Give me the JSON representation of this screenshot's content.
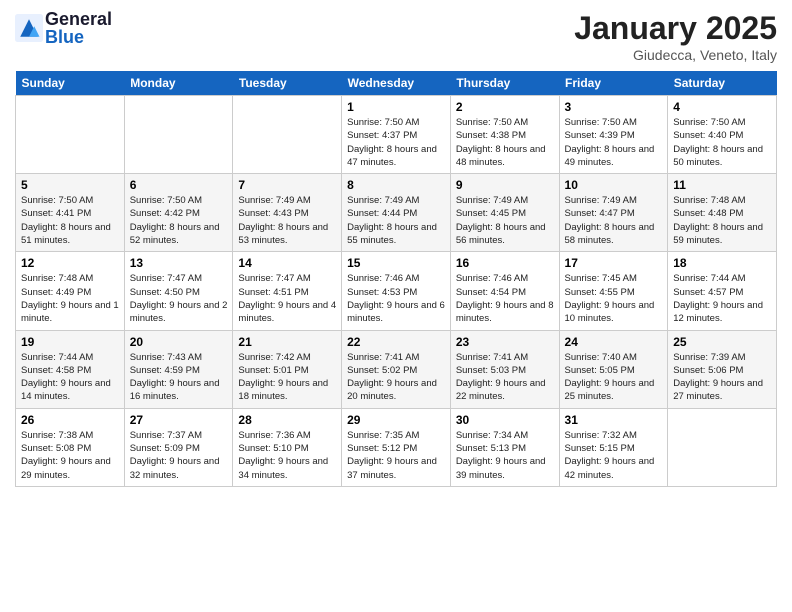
{
  "logo": {
    "text_general": "General",
    "text_blue": "Blue"
  },
  "header": {
    "month": "January 2025",
    "location": "Giudecca, Veneto, Italy"
  },
  "weekdays": [
    "Sunday",
    "Monday",
    "Tuesday",
    "Wednesday",
    "Thursday",
    "Friday",
    "Saturday"
  ],
  "weeks": [
    [
      {
        "day": "",
        "info": ""
      },
      {
        "day": "",
        "info": ""
      },
      {
        "day": "",
        "info": ""
      },
      {
        "day": "1",
        "info": "Sunrise: 7:50 AM\nSunset: 4:37 PM\nDaylight: 8 hours and 47 minutes."
      },
      {
        "day": "2",
        "info": "Sunrise: 7:50 AM\nSunset: 4:38 PM\nDaylight: 8 hours and 48 minutes."
      },
      {
        "day": "3",
        "info": "Sunrise: 7:50 AM\nSunset: 4:39 PM\nDaylight: 8 hours and 49 minutes."
      },
      {
        "day": "4",
        "info": "Sunrise: 7:50 AM\nSunset: 4:40 PM\nDaylight: 8 hours and 50 minutes."
      }
    ],
    [
      {
        "day": "5",
        "info": "Sunrise: 7:50 AM\nSunset: 4:41 PM\nDaylight: 8 hours and 51 minutes."
      },
      {
        "day": "6",
        "info": "Sunrise: 7:50 AM\nSunset: 4:42 PM\nDaylight: 8 hours and 52 minutes."
      },
      {
        "day": "7",
        "info": "Sunrise: 7:49 AM\nSunset: 4:43 PM\nDaylight: 8 hours and 53 minutes."
      },
      {
        "day": "8",
        "info": "Sunrise: 7:49 AM\nSunset: 4:44 PM\nDaylight: 8 hours and 55 minutes."
      },
      {
        "day": "9",
        "info": "Sunrise: 7:49 AM\nSunset: 4:45 PM\nDaylight: 8 hours and 56 minutes."
      },
      {
        "day": "10",
        "info": "Sunrise: 7:49 AM\nSunset: 4:47 PM\nDaylight: 8 hours and 58 minutes."
      },
      {
        "day": "11",
        "info": "Sunrise: 7:48 AM\nSunset: 4:48 PM\nDaylight: 8 hours and 59 minutes."
      }
    ],
    [
      {
        "day": "12",
        "info": "Sunrise: 7:48 AM\nSunset: 4:49 PM\nDaylight: 9 hours and 1 minute."
      },
      {
        "day": "13",
        "info": "Sunrise: 7:47 AM\nSunset: 4:50 PM\nDaylight: 9 hours and 2 minutes."
      },
      {
        "day": "14",
        "info": "Sunrise: 7:47 AM\nSunset: 4:51 PM\nDaylight: 9 hours and 4 minutes."
      },
      {
        "day": "15",
        "info": "Sunrise: 7:46 AM\nSunset: 4:53 PM\nDaylight: 9 hours and 6 minutes."
      },
      {
        "day": "16",
        "info": "Sunrise: 7:46 AM\nSunset: 4:54 PM\nDaylight: 9 hours and 8 minutes."
      },
      {
        "day": "17",
        "info": "Sunrise: 7:45 AM\nSunset: 4:55 PM\nDaylight: 9 hours and 10 minutes."
      },
      {
        "day": "18",
        "info": "Sunrise: 7:44 AM\nSunset: 4:57 PM\nDaylight: 9 hours and 12 minutes."
      }
    ],
    [
      {
        "day": "19",
        "info": "Sunrise: 7:44 AM\nSunset: 4:58 PM\nDaylight: 9 hours and 14 minutes."
      },
      {
        "day": "20",
        "info": "Sunrise: 7:43 AM\nSunset: 4:59 PM\nDaylight: 9 hours and 16 minutes."
      },
      {
        "day": "21",
        "info": "Sunrise: 7:42 AM\nSunset: 5:01 PM\nDaylight: 9 hours and 18 minutes."
      },
      {
        "day": "22",
        "info": "Sunrise: 7:41 AM\nSunset: 5:02 PM\nDaylight: 9 hours and 20 minutes."
      },
      {
        "day": "23",
        "info": "Sunrise: 7:41 AM\nSunset: 5:03 PM\nDaylight: 9 hours and 22 minutes."
      },
      {
        "day": "24",
        "info": "Sunrise: 7:40 AM\nSunset: 5:05 PM\nDaylight: 9 hours and 25 minutes."
      },
      {
        "day": "25",
        "info": "Sunrise: 7:39 AM\nSunset: 5:06 PM\nDaylight: 9 hours and 27 minutes."
      }
    ],
    [
      {
        "day": "26",
        "info": "Sunrise: 7:38 AM\nSunset: 5:08 PM\nDaylight: 9 hours and 29 minutes."
      },
      {
        "day": "27",
        "info": "Sunrise: 7:37 AM\nSunset: 5:09 PM\nDaylight: 9 hours and 32 minutes."
      },
      {
        "day": "28",
        "info": "Sunrise: 7:36 AM\nSunset: 5:10 PM\nDaylight: 9 hours and 34 minutes."
      },
      {
        "day": "29",
        "info": "Sunrise: 7:35 AM\nSunset: 5:12 PM\nDaylight: 9 hours and 37 minutes."
      },
      {
        "day": "30",
        "info": "Sunrise: 7:34 AM\nSunset: 5:13 PM\nDaylight: 9 hours and 39 minutes."
      },
      {
        "day": "31",
        "info": "Sunrise: 7:32 AM\nSunset: 5:15 PM\nDaylight: 9 hours and 42 minutes."
      },
      {
        "day": "",
        "info": ""
      }
    ]
  ]
}
